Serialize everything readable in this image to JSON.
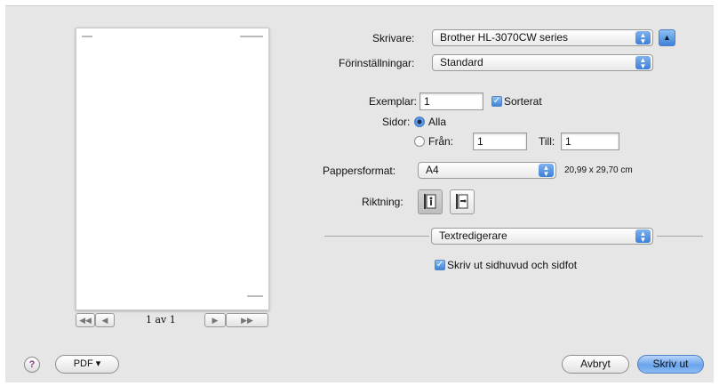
{
  "printer": {
    "label": "Skrivare:",
    "value": "Brother HL-3070CW series"
  },
  "presets": {
    "label": "Förinställningar:",
    "value": "Standard"
  },
  "copies": {
    "label": "Exemplar:",
    "value": "1",
    "collate_label": "Sorterat"
  },
  "pages": {
    "label": "Sidor:",
    "all_label": "Alla",
    "from_label": "Från:",
    "from_value": "1",
    "to_label": "Till:",
    "to_value": "1"
  },
  "paper_size": {
    "label": "Pappersformat:",
    "value": "A4",
    "dimensions": "20,99 x 29,70 cm"
  },
  "orientation": {
    "label": "Riktning:"
  },
  "section": {
    "value": "Textredigerare"
  },
  "header_footer": {
    "label": "Skriv ut sidhuvud och sidfot"
  },
  "preview": {
    "page_indicator": "1 av 1",
    "first": "◀◀",
    "prev": "◀",
    "next": "▶",
    "last": "▶▶"
  },
  "footer": {
    "help": "?",
    "pdf": "PDF ▾",
    "cancel": "Avbryt",
    "print": "Skriv ut"
  },
  "colors": {
    "accent": "#3c7fd8",
    "dialog_bg": "#e6e6e6"
  }
}
